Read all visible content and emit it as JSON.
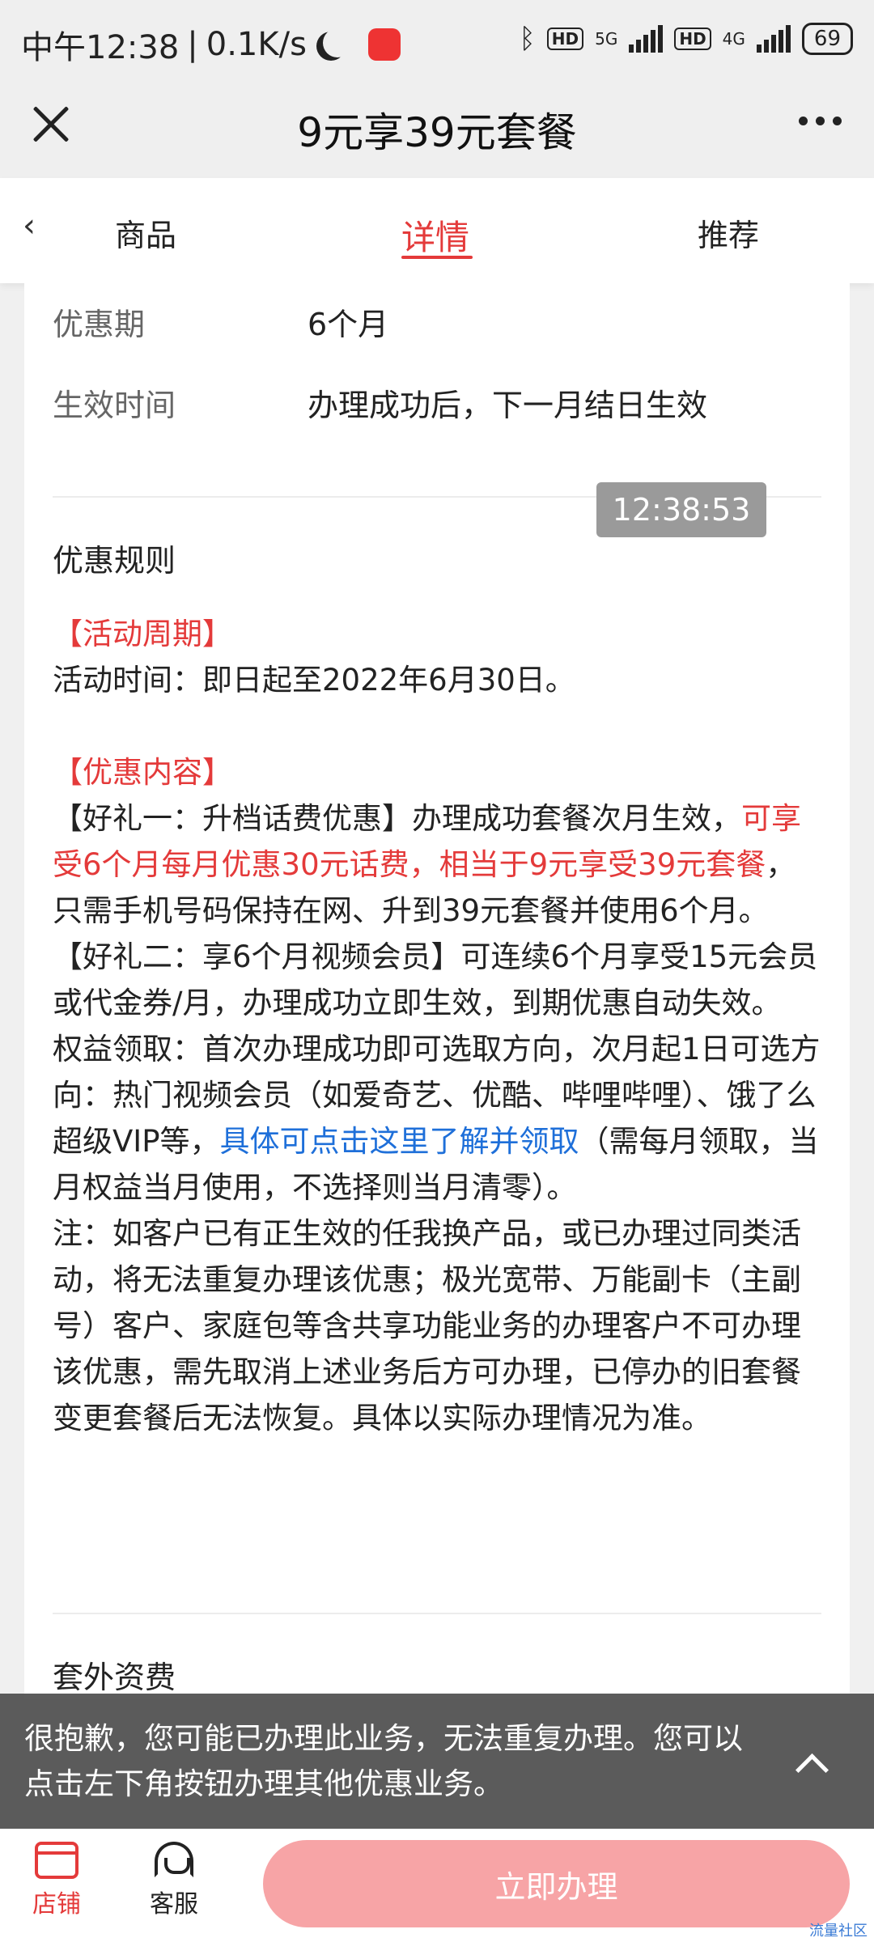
{
  "status_bar": {
    "time": "中午12:38",
    "speed": "0.1K/s",
    "network1": "5G",
    "network2": "4G",
    "hd": "HD",
    "battery": "69"
  },
  "title_bar": {
    "title": "9元享39元套餐"
  },
  "tabs": [
    {
      "label": "商品"
    },
    {
      "label": "详情"
    },
    {
      "label": "推荐"
    }
  ],
  "back_label": "‹",
  "info_rows": [
    {
      "label": "优惠期",
      "value": "6个月"
    },
    {
      "label": "生效时间",
      "value": "办理成功后，下一月结日生效"
    }
  ],
  "timestamp": "12:38:53",
  "rules_heading": "优惠规则",
  "rules": {
    "period_title": "【活动周期】",
    "period_text": "活动时间：即日起至2022年6月30日。",
    "content_title": "【优惠内容】",
    "gift1_head": "【好礼一：升档话费优惠】办理成功套餐次月生效，",
    "gift1_red": "可享受6个月每月优惠30元话费，相当于9元享受39元套餐",
    "gift1_tail": "，只需手机号码保持在网、升到39元套餐并使用6个月。",
    "gift2": "【好礼二：享6个月视频会员】可连续6个月享受15元会员或代金券/月，办理成功立即生效，到期优惠自动失效。",
    "claim_head": "权益领取：首次办理成功即可选取方向，次月起1日可选方向：热门视频会员（如爱奇艺、优酷、哔哩哔哩）、饿了么超级VIP等，",
    "claim_link": "具体可点击这里了解并领取",
    "claim_tail": "（需每月领取，当月权益当月使用，不选择则当月清零）。",
    "note": "注：如客户已有正生效的任我换产品，或已办理过同类活动，将无法重复办理该优惠；极光宽带、万能副卡（主副号）客户、家庭包等含共享功能业务的办理客户不可办理该优惠，需先取消上述业务后方可办理，已停办的旧套餐变更套餐后无法恢复。具体以实际办理情况为准。"
  },
  "extra_fee_heading": "套外资费",
  "toast": {
    "text": "很抱歉，您可能已办理此业务，无法重复办理。您可以点击左下角按钮办理其他优惠业务。"
  },
  "bottom_bar": {
    "shop_label": "店铺",
    "service_label": "客服",
    "apply_label": "立即办理"
  },
  "watermark": "流量社区"
}
